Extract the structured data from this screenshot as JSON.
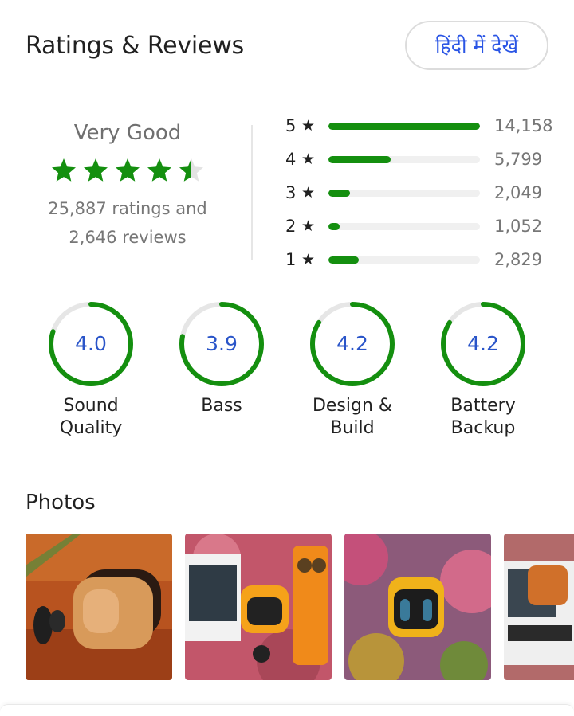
{
  "header": {
    "title": "Ratings & Reviews",
    "hindi_button": "हिंदी में देखें"
  },
  "summary": {
    "verdict": "Very Good",
    "stars_filled": 4.5,
    "ratings_line": "25,887 ratings and",
    "reviews_line": "2,646 reviews"
  },
  "distribution": [
    {
      "star": "5",
      "count": "14,158",
      "value": 14158
    },
    {
      "star": "4",
      "count": "5,799",
      "value": 5799
    },
    {
      "star": "3",
      "count": "2,049",
      "value": 2049
    },
    {
      "star": "2",
      "count": "1,052",
      "value": 1052
    },
    {
      "star": "1",
      "count": "2,829",
      "value": 2829
    }
  ],
  "aspects": [
    {
      "value": "4.0",
      "score": 4.0,
      "line1": "Sound",
      "line2": "Quality"
    },
    {
      "value": "3.9",
      "score": 3.9,
      "line1": "Bass",
      "line2": ""
    },
    {
      "value": "4.2",
      "score": 4.2,
      "line1": "Design &",
      "line2": "Build"
    },
    {
      "value": "4.2",
      "score": 4.2,
      "line1": "Battery",
      "line2": "Backup"
    }
  ],
  "photos": {
    "title": "Photos"
  },
  "colors": {
    "accent_green": "#148f0f",
    "rating_blue": "#2a55c9",
    "link_blue": "#2a55e5"
  }
}
